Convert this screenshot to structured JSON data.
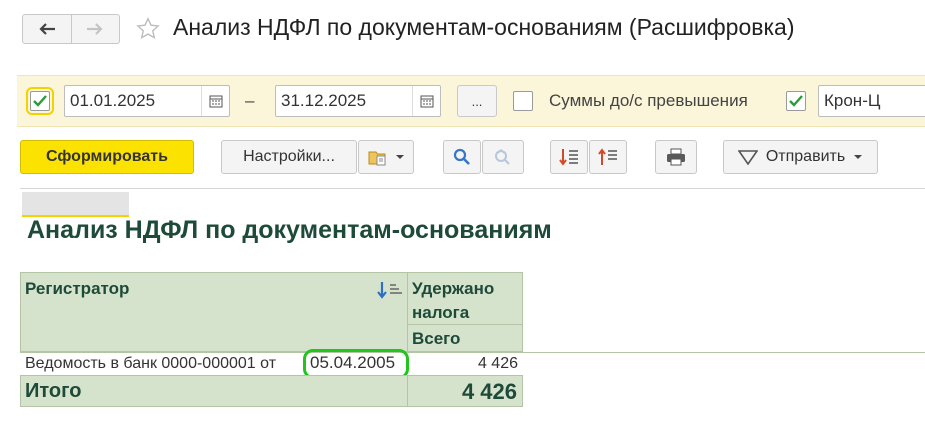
{
  "header": {
    "back_icon": "arrow-left-icon",
    "forward_icon": "arrow-right-icon",
    "favorite_icon": "star-icon",
    "title": "Анализ НДФЛ по документам-основаниям (Расшифровка)"
  },
  "filters": {
    "period_checked": true,
    "date_from": "01.01.2025",
    "dash": "–",
    "date_to": "31.12.2025",
    "period_button_label": "...",
    "excess_checked": false,
    "excess_label": "Суммы до/с превышения",
    "org_checked": true,
    "organization": "Крон-Ц"
  },
  "toolbar": {
    "generate_label": "Сформировать",
    "settings_label": "Настройки...",
    "send_label": "Отправить"
  },
  "report": {
    "title": "Анализ НДФЛ по документам-основаниям",
    "columns": {
      "registrar": "Регистратор",
      "withheld": "Удержано налога",
      "total": "Всего"
    },
    "rows": [
      {
        "registrar": "Ведомость в банк 0000-000001 от 05.04.2005",
        "registrar_prefix": "Ведомость в банк 0000-000001 от",
        "registrar_date": "05.04.2005",
        "total": "4 426"
      }
    ],
    "footer": {
      "label": "Итого",
      "total": "4 426"
    }
  },
  "colors": {
    "accent_yellow": "#fbe200",
    "header_green": "#d6e3cc",
    "title_green": "#1e4a3a",
    "highlight_green": "#22c51c",
    "checkbox_green": "#2e9a3a"
  }
}
